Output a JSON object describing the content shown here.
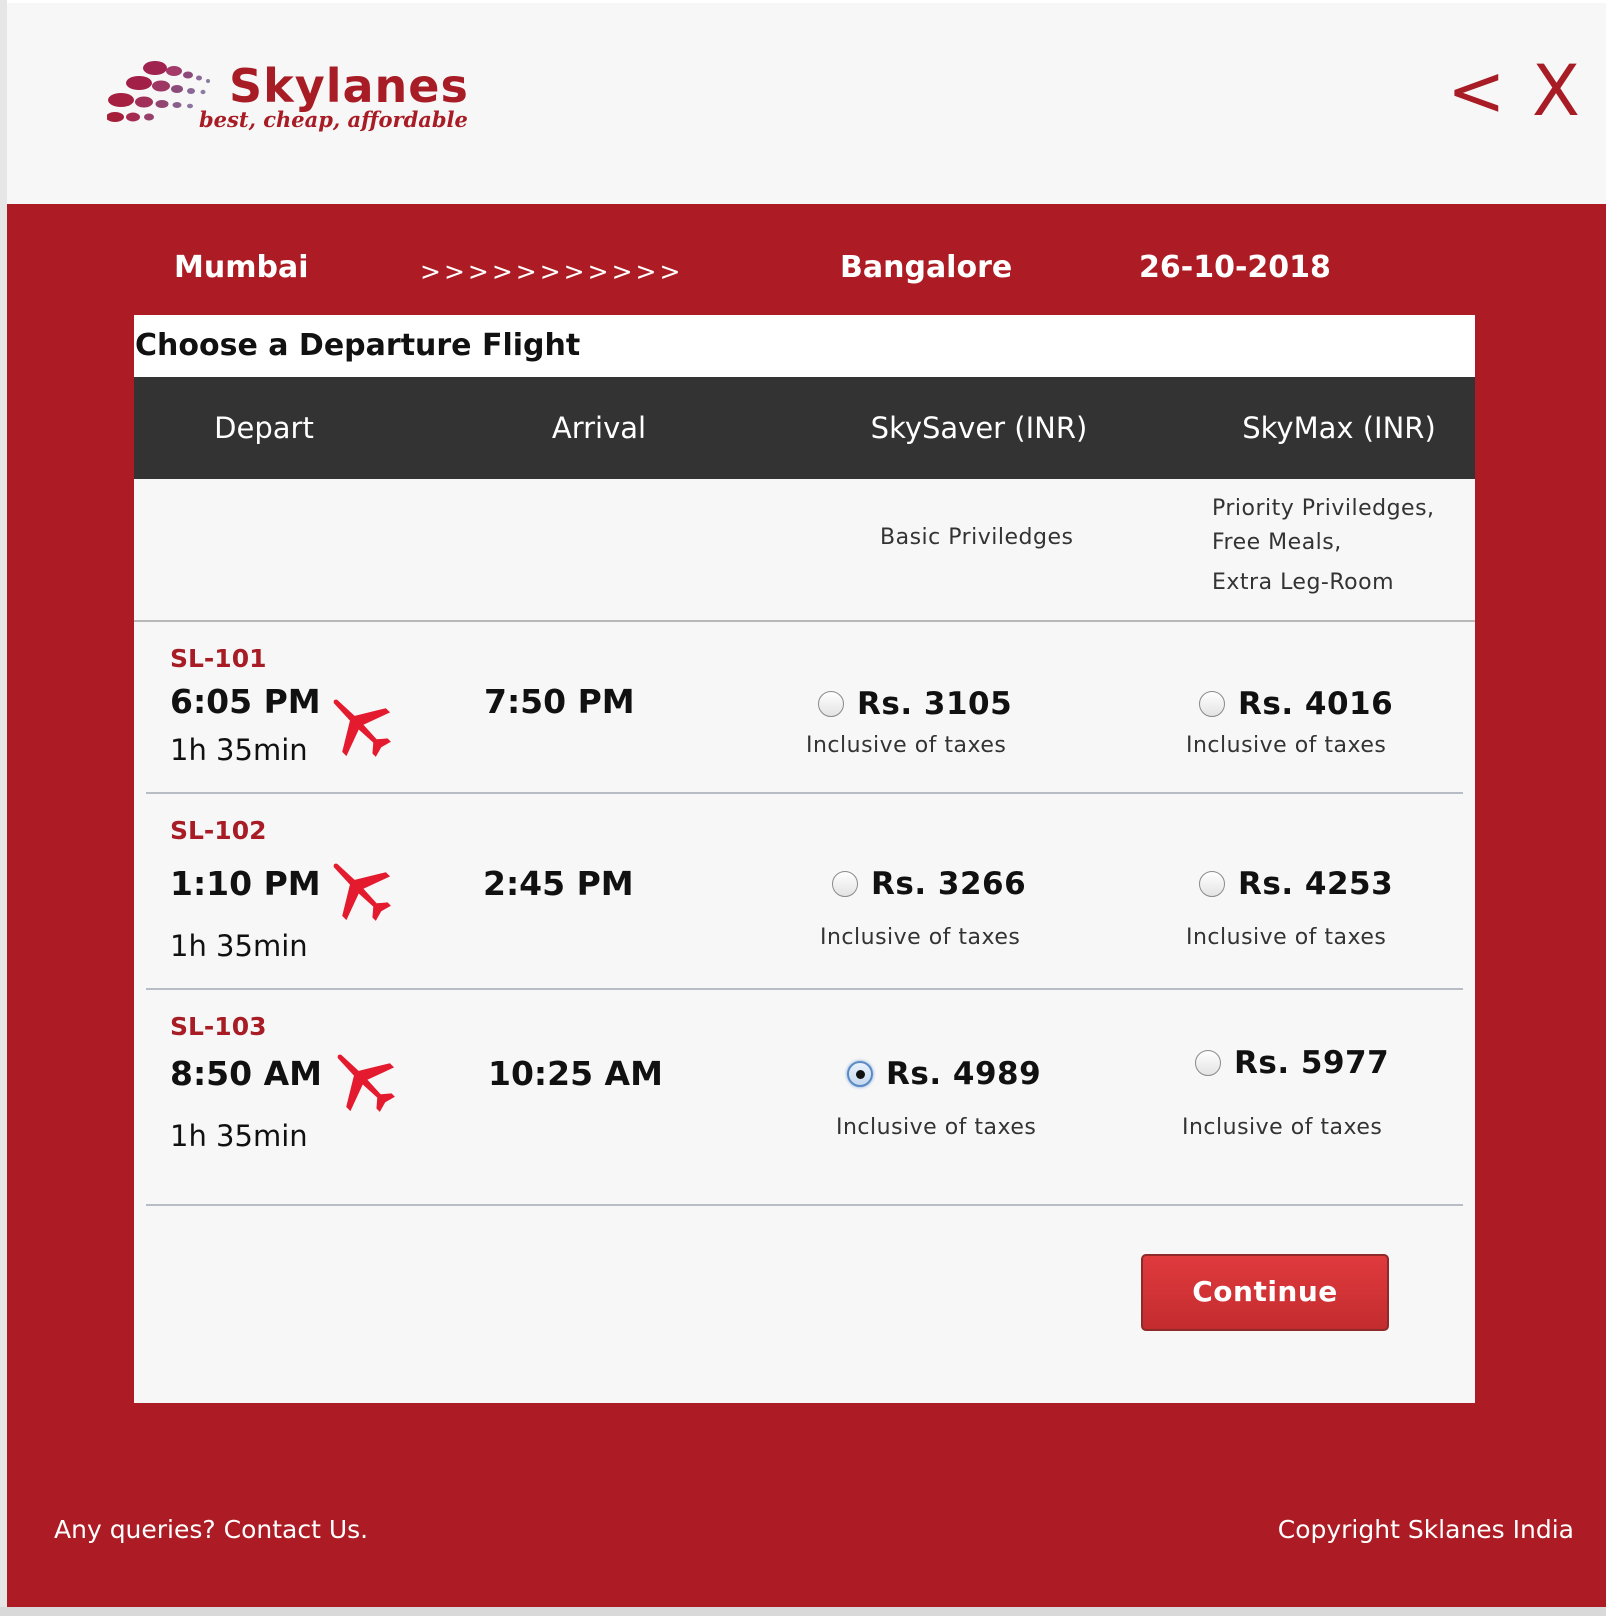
{
  "header": {
    "brand_name": "Skylanes",
    "tagline": "best, cheap, affordable",
    "back_label": "<",
    "close_label": "X",
    "brand_color": "#a81c25"
  },
  "route": {
    "from": "Mumbai",
    "arrows": ">>>>>>>>>>>",
    "to": "Bangalore",
    "date": "26-10-2018"
  },
  "panel": {
    "title": "Choose a Departure Flight",
    "columns": {
      "depart": "Depart",
      "arrival": "Arrival",
      "skysaver": "SkySaver (INR)",
      "skymax": "SkyMax (INR)"
    },
    "benefits": {
      "skysaver": "Basic Priviledges",
      "skymax": [
        "Priority Priviledges,",
        "Free Meals,",
        "Extra Leg-Room"
      ]
    }
  },
  "flights": [
    {
      "number": "SL-101",
      "depart": "6:05 PM",
      "duration": "1h 35min",
      "arrival": "7:50 PM",
      "skysaver": {
        "price": "Rs. 3105",
        "note": "Inclusive of taxes",
        "selected": false
      },
      "skymax": {
        "price": "Rs. 4016",
        "note": "Inclusive of taxes",
        "selected": false
      }
    },
    {
      "number": "SL-102",
      "depart": "1:10 PM",
      "duration": "1h 35min",
      "arrival": "2:45 PM",
      "skysaver": {
        "price": "Rs. 3266",
        "note": "Inclusive of taxes",
        "selected": false
      },
      "skymax": {
        "price": "Rs. 4253",
        "note": "Inclusive of taxes",
        "selected": false
      }
    },
    {
      "number": "SL-103",
      "depart": "8:50 AM",
      "duration": "1h 35min",
      "arrival": "10:25 AM",
      "skysaver": {
        "price": "Rs. 4989",
        "note": "Inclusive of taxes",
        "selected": true
      },
      "skymax": {
        "price": "Rs. 5977",
        "note": "Inclusive of taxes",
        "selected": false
      }
    }
  ],
  "actions": {
    "continue_label": "Continue"
  },
  "footer": {
    "contact": "Any queries? Contact Us.",
    "copyright": "Copyright Sklanes India"
  },
  "icons": {
    "plane": "airplane-icon",
    "logo": "skylanes-dots-logo"
  },
  "colors": {
    "primary_red": "#ad1c24",
    "table_header": "#333333",
    "selected_radio": "#5a8ac4"
  }
}
